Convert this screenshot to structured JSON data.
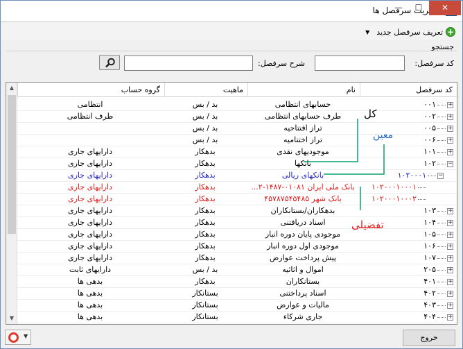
{
  "window": {
    "title": "مدیریت سرفصل ها",
    "close": "✕",
    "maximize": "☐",
    "minimize": "—"
  },
  "menu": {
    "new_label": "تعریف سرفصل جدید"
  },
  "search": {
    "group_label": "جستجو",
    "code_label": "کد سرفصل:",
    "desc_label": "شرح سرفصل:",
    "code_value": "",
    "desc_value": ""
  },
  "grid": {
    "columns": {
      "code": "کد سرفصل",
      "name": "نام",
      "nature": "ماهیت",
      "group": "گروه حساب"
    },
    "rows": [
      {
        "code": "۰۰۱",
        "name": "حسابهای انتظامی",
        "nature": "بد / بس",
        "group": "انتظامی",
        "style": "normal",
        "level": 0,
        "exp": "+"
      },
      {
        "code": "۰۰۲",
        "name": "طرف حسابهای انتظامی",
        "nature": "بد / بس",
        "group": "طرف انتظامی",
        "style": "normal",
        "level": 0,
        "exp": "+"
      },
      {
        "code": "۰۰۵",
        "name": "تراز افتتاحیه",
        "nature": "بد / بس",
        "group": "",
        "style": "normal",
        "level": 0,
        "exp": "+"
      },
      {
        "code": "۰۰۶",
        "name": "تراز اختتامیه",
        "nature": "بد / بس",
        "group": "",
        "style": "normal",
        "level": 0,
        "exp": "+"
      },
      {
        "code": "۱۰۱",
        "name": "موجودیهای نقدی",
        "nature": "بدهکار",
        "group": "دارایهای جاری",
        "style": "normal",
        "level": 0,
        "exp": "+"
      },
      {
        "code": "۱۰۲",
        "name": "بانکها",
        "nature": "بدهکار",
        "group": "دارایهای جاری",
        "style": "normal",
        "level": 0,
        "exp": "−"
      },
      {
        "code": "۱۰۲۰۰۰۱",
        "name": "بانکهای ریالی",
        "nature": "بدهکار",
        "group": "دارایهای جاری",
        "style": "blue",
        "level": 1,
        "exp": "−"
      },
      {
        "code": "۱۰۲۰۰۰۱۰۰۰۱",
        "name": "بانک ملی ایران ۰۱۰۸۱-۱۴۸۷-۲...",
        "nature": "بدهکار",
        "group": "دارایهای جاری",
        "style": "red",
        "level": 2,
        "exp": ""
      },
      {
        "code": "۱۰۲۰۰۰۱۰۰۰۲",
        "name": "بانک شهر ۴۵۷۸۷۵۴۵۴۸۵",
        "nature": "بدهکار",
        "group": "دارایهای جاری",
        "style": "red",
        "level": 2,
        "exp": ""
      },
      {
        "code": "۱۰۳",
        "name": "بدهکاران/بستانکاران",
        "nature": "بدهکار",
        "group": "دارایهای جاری",
        "style": "normal",
        "level": 0,
        "exp": "+"
      },
      {
        "code": "۱۰۴",
        "name": "اسناد دریافتنی",
        "nature": "بدهکار",
        "group": "دارایهای جاری",
        "style": "normal",
        "level": 0,
        "exp": "+"
      },
      {
        "code": "۱۰۵",
        "name": "موجودی پایان دوره انبار",
        "nature": "بدهکار",
        "group": "دارایهای جاری",
        "style": "normal",
        "level": 0,
        "exp": "+"
      },
      {
        "code": "۱۰۶",
        "name": "موجودی اول دوره انبار",
        "nature": "بدهکار",
        "group": "دارایهای جاری",
        "style": "normal",
        "level": 0,
        "exp": "+"
      },
      {
        "code": "۱۰۷",
        "name": "پیش پرداخت عوارض",
        "nature": "بدهکار",
        "group": "دارایهای جاری",
        "style": "normal",
        "level": 0,
        "exp": "+"
      },
      {
        "code": "۲۰۵",
        "name": "اموال و اثاثیه",
        "nature": "بد / بس",
        "group": "دارایهای ثابت",
        "style": "normal",
        "level": 0,
        "exp": "+"
      },
      {
        "code": "۴۰۱",
        "name": "بستانکاران",
        "nature": "بدهکار",
        "group": "بدهی ها",
        "style": "normal",
        "level": 0,
        "exp": "+"
      },
      {
        "code": "۴۰۲",
        "name": "اسناد پرداختنی",
        "nature": "بستانکار",
        "group": "بدهی ها",
        "style": "normal",
        "level": 0,
        "exp": "+"
      },
      {
        "code": "۴۰۳",
        "name": "مالیات و عوارض",
        "nature": "بستانکار",
        "group": "بدهی ها",
        "style": "normal",
        "level": 0,
        "exp": "+"
      },
      {
        "code": "۴۰۴",
        "name": "جاری شرکاء",
        "nature": "بستانکار",
        "group": "بدهی ها",
        "style": "normal",
        "level": 0,
        "exp": "+"
      }
    ]
  },
  "annotations": {
    "kol": "کل",
    "moin": "معین",
    "tafsili": "تفضیلی",
    "colors": {
      "kol": "#000000",
      "moin": "#1f64c8",
      "tafsili": "#e82020"
    }
  },
  "footer": {
    "exit_label": "خروج"
  },
  "colors": {
    "blue_row": "#2020c8",
    "red_row": "#e01818",
    "green_marker": "#0aa06e"
  }
}
